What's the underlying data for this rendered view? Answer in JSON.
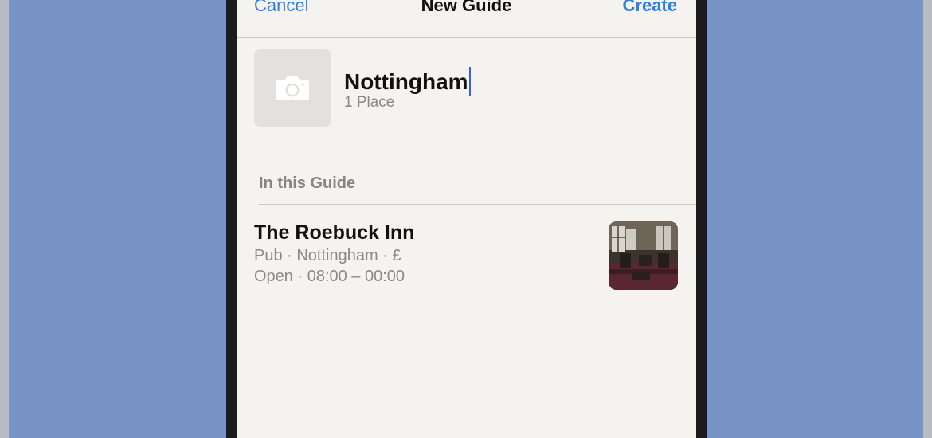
{
  "nav": {
    "cancel_label": "Cancel",
    "title": "New Guide",
    "create_label": "Create"
  },
  "guide": {
    "name": "Nottingham",
    "count": "1 Place",
    "photo_icon": "camera-icon"
  },
  "section": {
    "header": "In this Guide"
  },
  "places": [
    {
      "name": "The Roebuck Inn",
      "meta": "Pub · Nottingham · £",
      "hours": "Open · 08:00 – 00:00"
    }
  ],
  "colors": {
    "accent": "#2f7ee0",
    "background": "#7893c5",
    "screen": "#f4f3f0",
    "secondary_text": "#8a8986"
  }
}
